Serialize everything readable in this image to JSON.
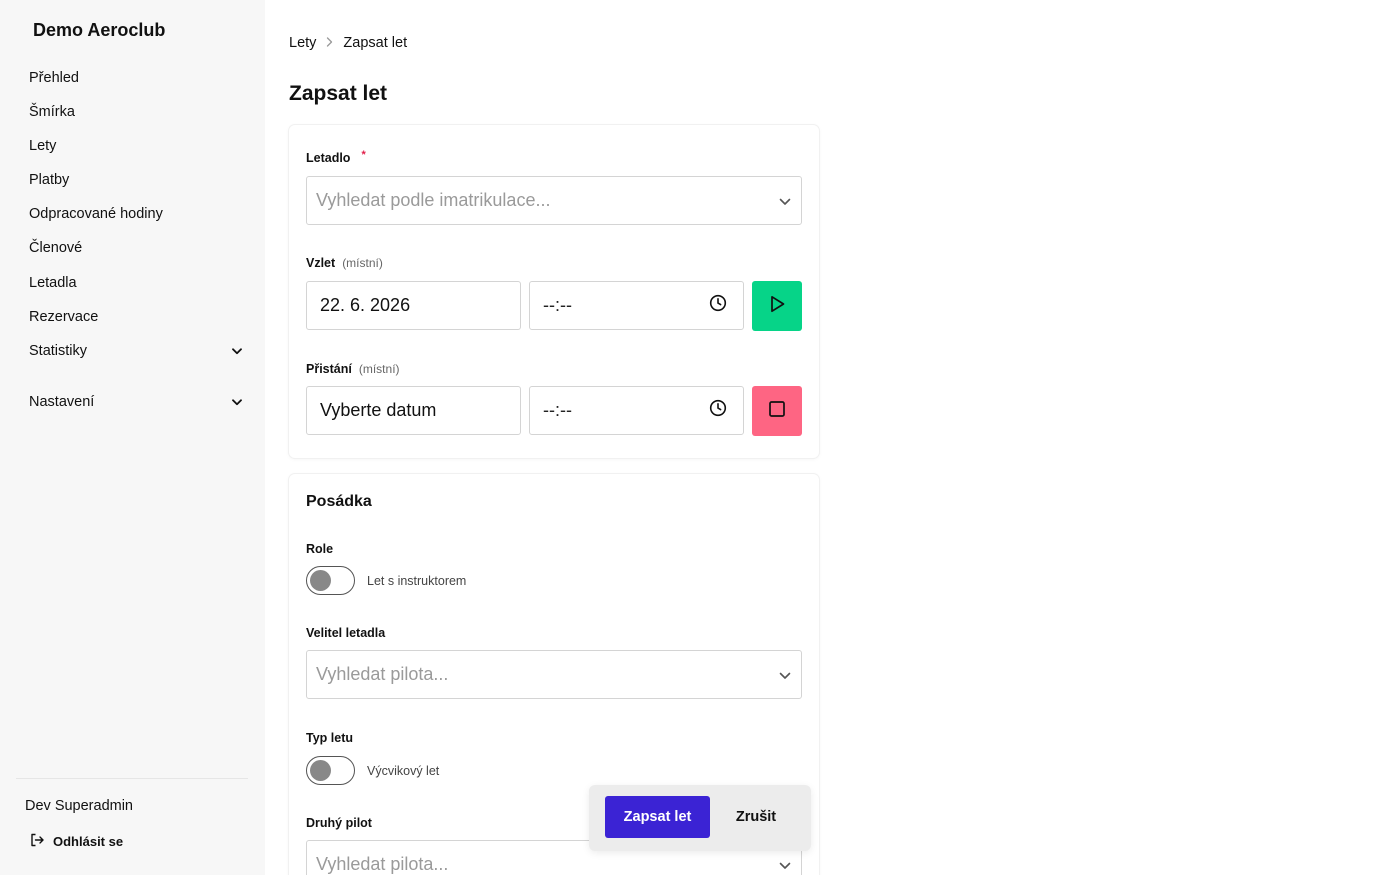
{
  "app": {
    "title": "Demo Aeroclub"
  },
  "sidebar": {
    "items": [
      {
        "label": "Přehled"
      },
      {
        "label": "Šmírka"
      },
      {
        "label": "Lety"
      },
      {
        "label": "Platby"
      },
      {
        "label": "Odpracované hodiny"
      },
      {
        "label": "Členové"
      },
      {
        "label": "Letadla"
      },
      {
        "label": "Rezervace"
      },
      {
        "label": "Statistiky",
        "icon": "chevron-down-icon"
      },
      {
        "label": "Nastavení",
        "icon": "chevron-down-icon"
      }
    ],
    "user": "Dev Superadmin",
    "logout": {
      "label": "Odhlásit se",
      "icon": "logout-icon"
    }
  },
  "breadcrumb": {
    "items": [
      "Lety",
      "Zapsat let"
    ],
    "separator_icon": "chevron-right-icon"
  },
  "page": {
    "title": "Zapsat let"
  },
  "flight": {
    "aircraft": {
      "label": "Letadlo",
      "required_mark": "*",
      "placeholder": "Vyhledat podle imatrikulace..."
    },
    "takeoff": {
      "label": "Vzlet",
      "hint": "(místní)",
      "date": "22. 6. 2026",
      "time": "--:--",
      "button_icon": "play-icon"
    },
    "landing": {
      "label": "Přistání",
      "hint": "(místní)",
      "date": "Vyberte datum",
      "time": "--:--",
      "button_icon": "stop-icon"
    }
  },
  "crew": {
    "title": "Posádka",
    "role": {
      "label": "Role",
      "toggle_text": "Let s instruktorem",
      "on": false
    },
    "commander": {
      "label": "Velitel letadla",
      "placeholder": "Vyhledat pilota..."
    },
    "flight_type": {
      "label": "Typ letu",
      "toggle_text": "Výcvikový let",
      "on": false
    },
    "second_pilot": {
      "label": "Druhý pilot",
      "placeholder": "Vyhledat pilota..."
    }
  },
  "actions": {
    "submit": "Zapsat let",
    "cancel": "Zrušit"
  },
  "colors": {
    "primary": "#3b23d4",
    "start": "#06d488",
    "stop": "#fe6583",
    "required": "#e11d48",
    "sidebar_bg": "#f7f7f7"
  }
}
